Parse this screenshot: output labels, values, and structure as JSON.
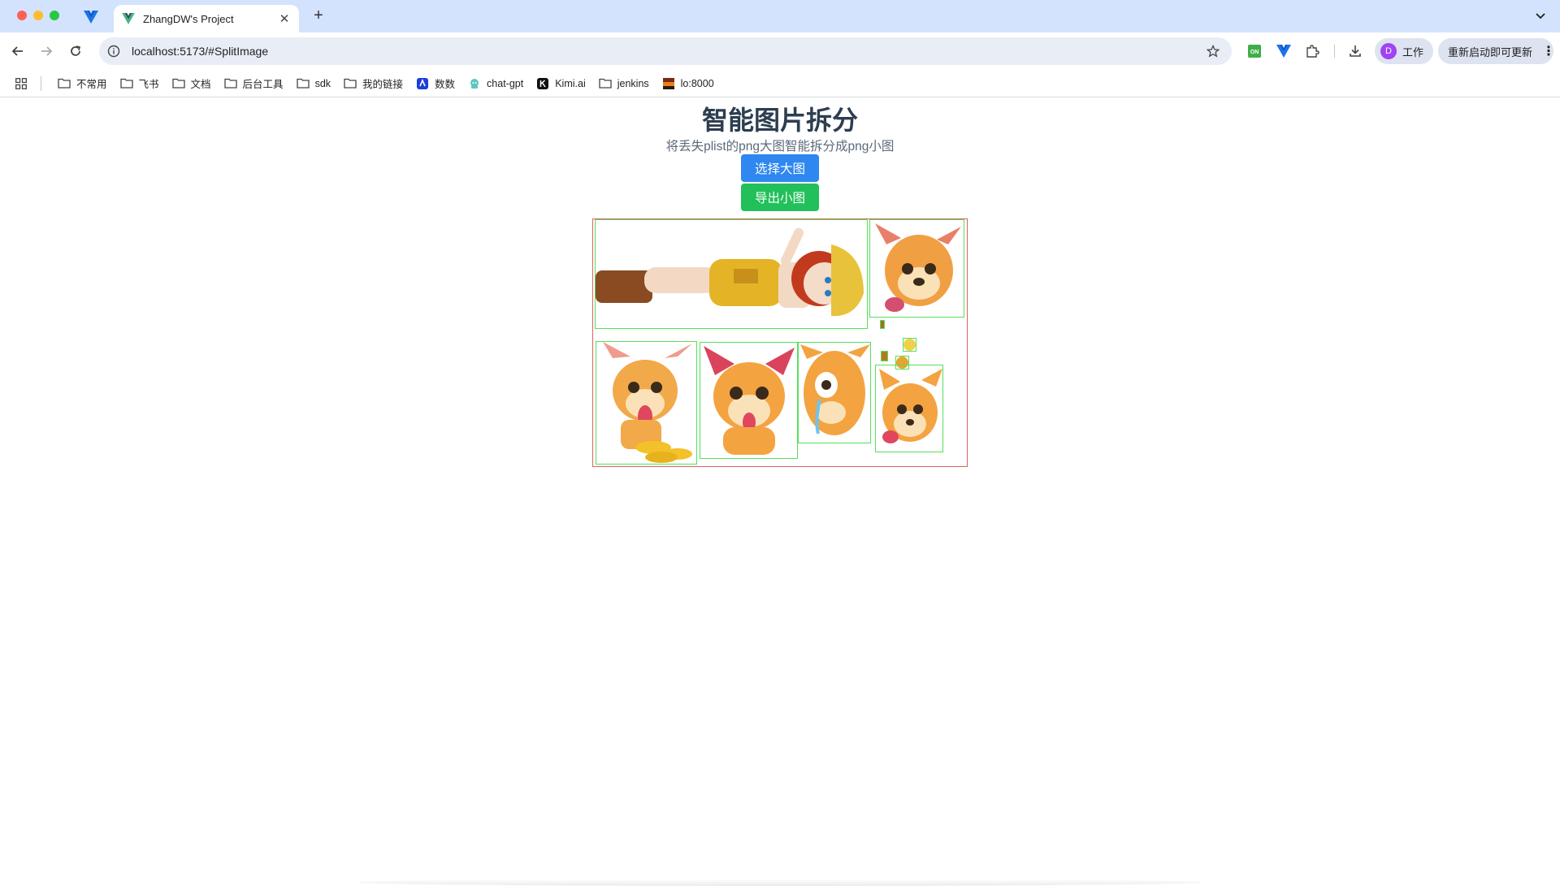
{
  "browser": {
    "tab": {
      "title": "ZhangDW's Project"
    },
    "address": {
      "url": "localhost:5173/#SplitImage"
    },
    "profile": {
      "initial": "D",
      "name": "工作"
    },
    "update_label": "重新启动即可更新",
    "bookmarks": [
      {
        "label": "不常用",
        "icon": "folder-icon"
      },
      {
        "label": "飞书",
        "icon": "folder-icon"
      },
      {
        "label": "文档",
        "icon": "folder-icon"
      },
      {
        "label": "后台工具",
        "icon": "folder-icon"
      },
      {
        "label": "sdk",
        "icon": "folder-icon"
      },
      {
        "label": "我的链接",
        "icon": "folder-icon"
      },
      {
        "label": "数数",
        "icon": "shushu-icon"
      },
      {
        "label": "chat-gpt",
        "icon": "chatgpt-icon"
      },
      {
        "label": "Kimi.ai",
        "icon": "kimi-icon"
      },
      {
        "label": "jenkins",
        "icon": "folder-icon"
      },
      {
        "label": "lo:8000",
        "icon": "site-icon"
      }
    ],
    "extension_badge": "ON"
  },
  "page": {
    "title": "智能图片拆分",
    "subtitle": "将丢失plist的png大图智能拆分成png小图",
    "select_button": "选择大图",
    "export_button": "导出小图"
  },
  "colors": {
    "select_button": "#2f87f0",
    "export_button": "#22c05a",
    "canvas_border": "#e06060",
    "sprite_border": "#55e05a",
    "heading": "#2c3e50"
  }
}
